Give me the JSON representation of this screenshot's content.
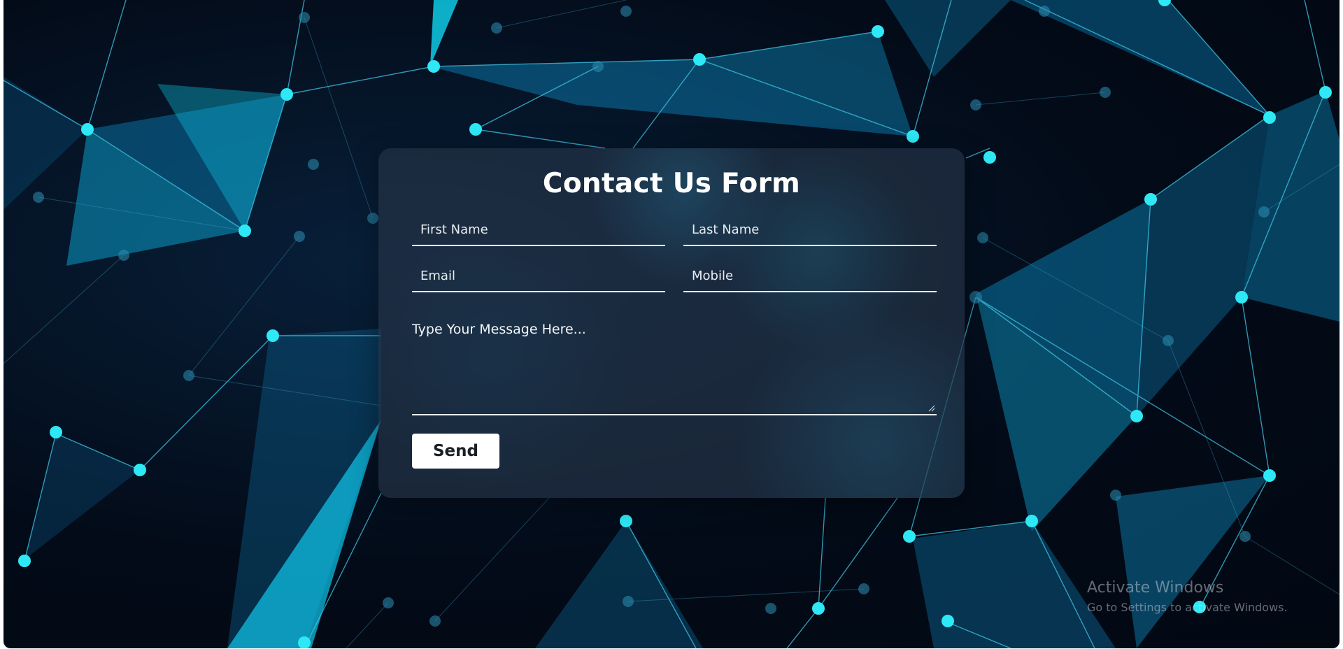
{
  "form": {
    "title": "Contact Us Form",
    "first_name_placeholder": "First Name",
    "last_name_placeholder": "Last Name",
    "email_placeholder": "Email",
    "mobile_placeholder": "Mobile",
    "message_placeholder": "Type Your Message Here...",
    "send_label": "Send"
  },
  "watermark": {
    "line1": "Activate Windows",
    "line2": "Go to Settings to activate Windows."
  },
  "colors": {
    "node": "#2ee8f5",
    "line": "#3fc6e6",
    "background": "#030b18",
    "card": "#243246"
  }
}
